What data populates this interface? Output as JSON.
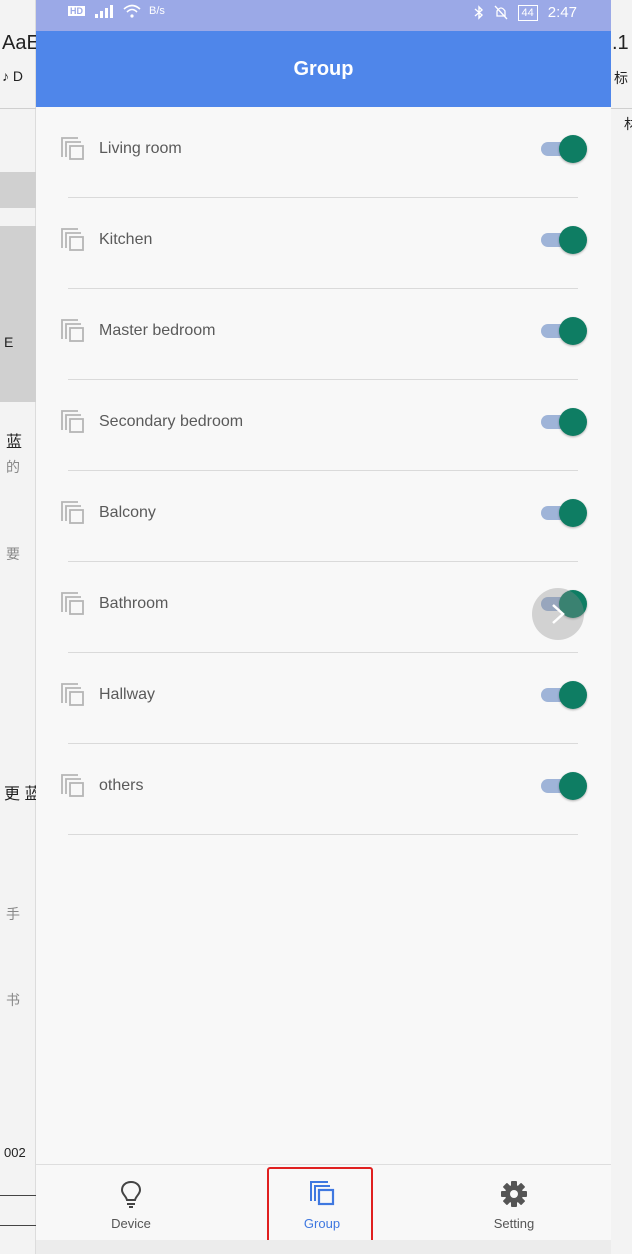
{
  "status_bar": {
    "left_badge": "HD",
    "network_speed": "B/s",
    "battery": "44",
    "time": "2:47"
  },
  "app_bar": {
    "title": "Group"
  },
  "groups": [
    {
      "label": "Living room",
      "enabled": true
    },
    {
      "label": "Kitchen",
      "enabled": true
    },
    {
      "label": "Master bedroom",
      "enabled": true
    },
    {
      "label": "Secondary bedroom",
      "enabled": true
    },
    {
      "label": "Balcony",
      "enabled": true
    },
    {
      "label": "Bathroom",
      "enabled": true
    },
    {
      "label": "Hallway",
      "enabled": true
    },
    {
      "label": "others",
      "enabled": true
    }
  ],
  "bottom_nav": {
    "items": [
      {
        "label": "Device",
        "icon": "lightbulb-icon"
      },
      {
        "label": "Group",
        "icon": "group-icon",
        "active": true
      },
      {
        "label": "Setting",
        "icon": "gear-icon"
      }
    ]
  },
  "background": {
    "left_texts": [
      "AaE",
      "♪ D",
      "E",
      "蓝",
      "的",
      "要",
      "更 蓝",
      "手",
      "书",
      "002"
    ],
    "right_texts": [
      ".1",
      "标",
      "材"
    ]
  },
  "colors": {
    "app_bar": "#4f86ea",
    "status_bar": "#9ba9e7",
    "toggle_thumb": "#0e7d63",
    "toggle_track": "#9fb4d8",
    "active_nav": "#3f78e0",
    "highlight": "#e02020"
  }
}
